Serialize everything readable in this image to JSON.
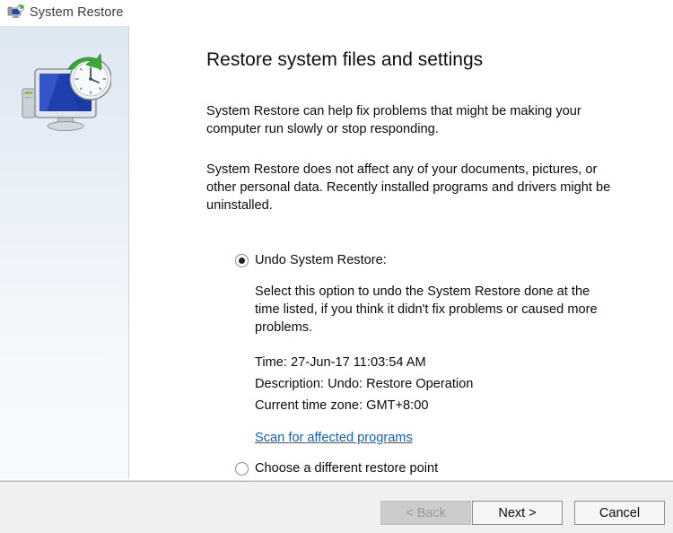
{
  "window": {
    "title": "System Restore",
    "title_icon": "system-restore-icon",
    "export_icon": "export-arrow-icon",
    "close_icon": "close-icon"
  },
  "sidebar": {
    "illustration": "system-restore-computer-clock-illustration"
  },
  "main": {
    "heading": "Restore system files and settings",
    "paragraph_1": "System Restore can help fix problems that might be making your computer run slowly or stop responding.",
    "paragraph_2": "System Restore does not affect any of your documents, pictures, or other personal data. Recently installed programs and drivers might be uninstalled.",
    "options": [
      {
        "label": "Undo System Restore:",
        "selected": true,
        "description": "Select this option to undo the System Restore done at the time listed, if you think it didn't fix problems or caused more problems.",
        "details": [
          "Time: 27-Jun-17 11:03:54 AM",
          "Description: Undo: Restore Operation",
          "Current time zone: GMT+8:00"
        ],
        "link": "Scan for affected programs"
      },
      {
        "label": "Choose a different restore point",
        "selected": false
      }
    ]
  },
  "footer": {
    "back_label": "< Back",
    "next_label": "Next >",
    "cancel_label": "Cancel"
  },
  "colors": {
    "link": "#0c62c6",
    "sidebar_top": "#dde7f2",
    "footer_bg": "#f0f0f0"
  }
}
